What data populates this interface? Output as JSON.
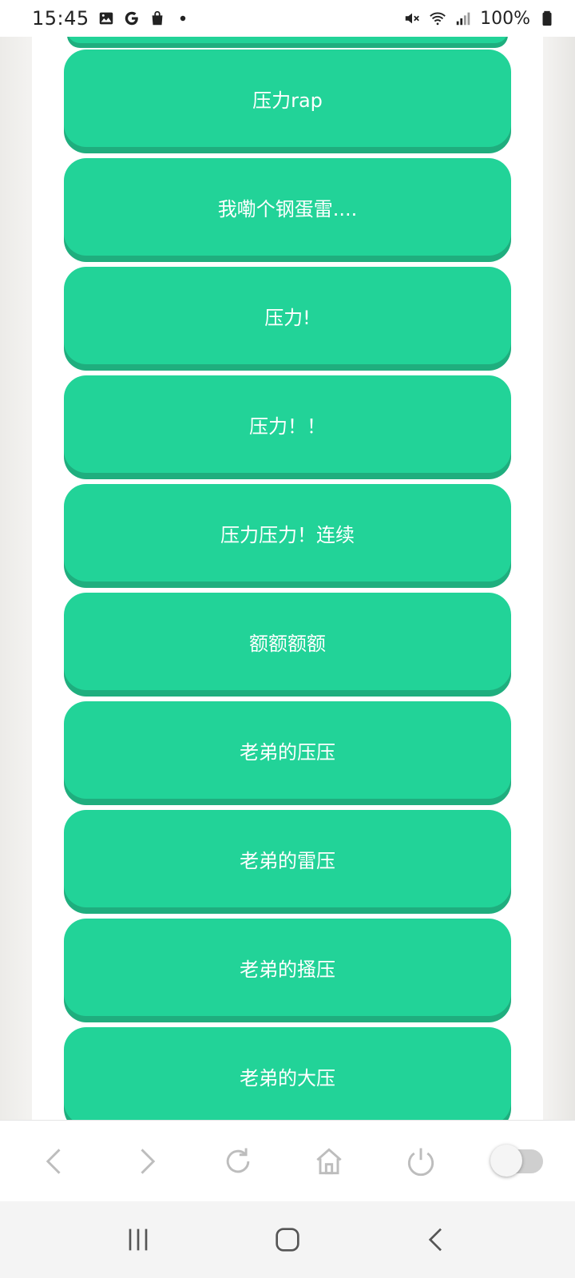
{
  "status_bar": {
    "time": "15:45",
    "left_icons": [
      "image-icon",
      "google-icon",
      "shopping-bag-icon",
      "notification-dot-icon"
    ],
    "right_icons": [
      "mute-icon",
      "wifi-icon",
      "signal-icon",
      "battery-icon"
    ],
    "battery_text": "100%"
  },
  "buttons": [
    {
      "label": "压力rap"
    },
    {
      "label": "我嘞个钢蛋雷...."
    },
    {
      "label": "压力!"
    },
    {
      "label": "压力！！"
    },
    {
      "label": "压力压力！连续"
    },
    {
      "label": "额额额额"
    },
    {
      "label": "老弟的压压"
    },
    {
      "label": "老弟的雷压"
    },
    {
      "label": "老弟的搔压"
    },
    {
      "label": "老弟的大压"
    }
  ],
  "toolbar": {
    "icons": [
      "back-icon",
      "forward-icon",
      "reload-icon",
      "home-icon",
      "power-icon"
    ],
    "toggle_state": "off"
  },
  "nav_bar": {
    "icons": [
      "recents-icon",
      "home-icon",
      "back-icon"
    ]
  },
  "colors": {
    "button_bg": "#22d398",
    "button_shadow": "#1fae7e",
    "button_text": "#ffffff"
  }
}
